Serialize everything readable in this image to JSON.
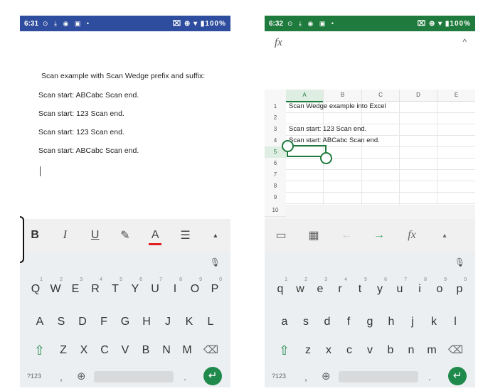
{
  "left": {
    "status": {
      "time": "6:31",
      "icons": "⊙ ⤓ ◉ ▣ •",
      "right": "⌧ ⊕ ▾ ▮100%"
    },
    "document": {
      "lines": [
        "Scan example with Scan Wedge prefix and suffix:",
        "Scan start: ABCabc Scan end.",
        "Scan start: 123 Scan end.",
        "Scan start: 123 Scan end.",
        "Scan start: ABCabc Scan end."
      ]
    },
    "toolbar": {
      "bold": "B",
      "italic": "I",
      "underline": "U",
      "highlight": "✎",
      "font_color": "A",
      "list": "☰",
      "more": "▴"
    }
  },
  "right": {
    "status": {
      "time": "6:32",
      "icons": "⊙ ⤓ ◉ ▣ •",
      "right": "⌧ ⊕ ▾ ▮100%"
    },
    "formula_bar": {
      "fx": "fx",
      "chevron": "^"
    },
    "sheet": {
      "columns": [
        "A",
        "B",
        "C",
        "D",
        "E"
      ],
      "rows": [
        "1",
        "2",
        "3",
        "4",
        "5",
        "6",
        "7",
        "8",
        "9",
        "10"
      ],
      "cells": {
        "a1": "Scan Wedge example into Excel",
        "a3": "Scan start: 123 Scan end.",
        "a4": "Scan start: ABCabc Scan end."
      }
    },
    "toolbar": {
      "comment": "▭",
      "table": "▦",
      "undo": "←",
      "redo": "→",
      "fx": "fx",
      "more": "▴"
    }
  },
  "keyboard_upper": {
    "row1": [
      "Q",
      "W",
      "E",
      "R",
      "T",
      "Y",
      "U",
      "I",
      "O",
      "P"
    ],
    "row1_nums": [
      "1",
      "2",
      "3",
      "4",
      "5",
      "6",
      "7",
      "8",
      "9",
      "0"
    ],
    "row2": [
      "A",
      "S",
      "D",
      "F",
      "G",
      "H",
      "J",
      "K",
      "L"
    ],
    "row3": [
      "Z",
      "X",
      "C",
      "V",
      "B",
      "N",
      "M"
    ]
  },
  "keyboard_lower": {
    "row1": [
      "q",
      "w",
      "e",
      "r",
      "t",
      "y",
      "u",
      "i",
      "o",
      "p"
    ],
    "row1_nums": [
      "1",
      "2",
      "3",
      "4",
      "5",
      "6",
      "7",
      "8",
      "9",
      "0"
    ],
    "row2": [
      "a",
      "s",
      "d",
      "f",
      "g",
      "h",
      "j",
      "k",
      "l"
    ],
    "row3": [
      "z",
      "x",
      "c",
      "v",
      "b",
      "n",
      "m"
    ]
  },
  "keyboard_common": {
    "mic": "🎙",
    "shift": "⇧",
    "backspace": "⌫",
    "mode": "?123",
    "comma": ",",
    "globe": "⊕",
    "period": ".",
    "enter": "↵"
  }
}
